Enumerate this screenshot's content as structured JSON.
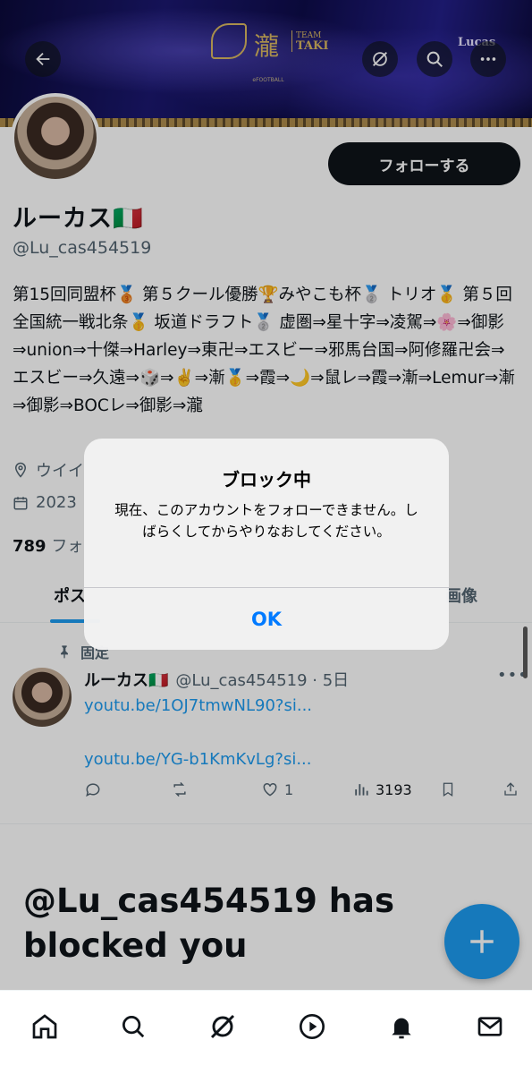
{
  "banner": {
    "logo_kanji": "瀧",
    "logo_team": "TEAM",
    "logo_name": "TAKI",
    "logo_sub": "eFOOTBALL",
    "corner_name": "Lucas"
  },
  "header_buttons": [
    "back-arrow-icon",
    "grok-icon",
    "search-icon",
    "more-icon"
  ],
  "profile": {
    "display_name": "ルーカス🇮🇹",
    "handle": "@Lu_cas454519",
    "follow_label": "フォローする",
    "bio": "第15回同盟杯🥉 第５クール優勝🏆みやこも杯🥈 トリオ🥇 第５回全国統一戦北条🥇 坂道ドラフト🥈 虚圏⇒星十字⇒凌駕⇒🌸⇒御影⇒union⇒十傑⇒Harley⇒東卍⇒エスビー⇒邪馬台国⇒阿修羅卍会⇒ エスビー⇒久遠⇒🎲⇒✌️⇒漸🥇⇒霞⇒🌙⇒鼠レ⇒霞⇒漸⇒Lemur⇒漸⇒御影⇒BOCレ⇒御影⇒瀧",
    "location": "ウイイ",
    "joined": "2023",
    "followers_count": "789",
    "followers_label": "フォ"
  },
  "tabs": {
    "posts": "ポス",
    "media": "画像"
  },
  "pinned_post": {
    "pinned_label": "固定",
    "author_name": "ルーカス🇮🇹",
    "author_handle_time": "@Lu_cas454519 · 5日",
    "link1": "youtu.be/1OJ7tmwNL90?si...",
    "link2": "youtu.be/YG-b1KmKvLg?si...",
    "likes": "1",
    "views": "3193"
  },
  "blocked": {
    "title": "@Lu_cas454519 has blocked you",
    "subtitle": "…"
  },
  "alert": {
    "title": "ブロック中",
    "message": "現在、このアカウントをフォローできません。しばらくしてからやりなおしてください。",
    "ok_label": "OK"
  },
  "bottom_nav": [
    "home-icon",
    "search-icon",
    "grok-icon",
    "video-icon",
    "notifications-icon",
    "messages-icon"
  ],
  "colors": {
    "accent": "#1d9bf0",
    "alert_button": "#007aff",
    "text_primary": "#0f1419",
    "text_secondary": "#536471"
  }
}
